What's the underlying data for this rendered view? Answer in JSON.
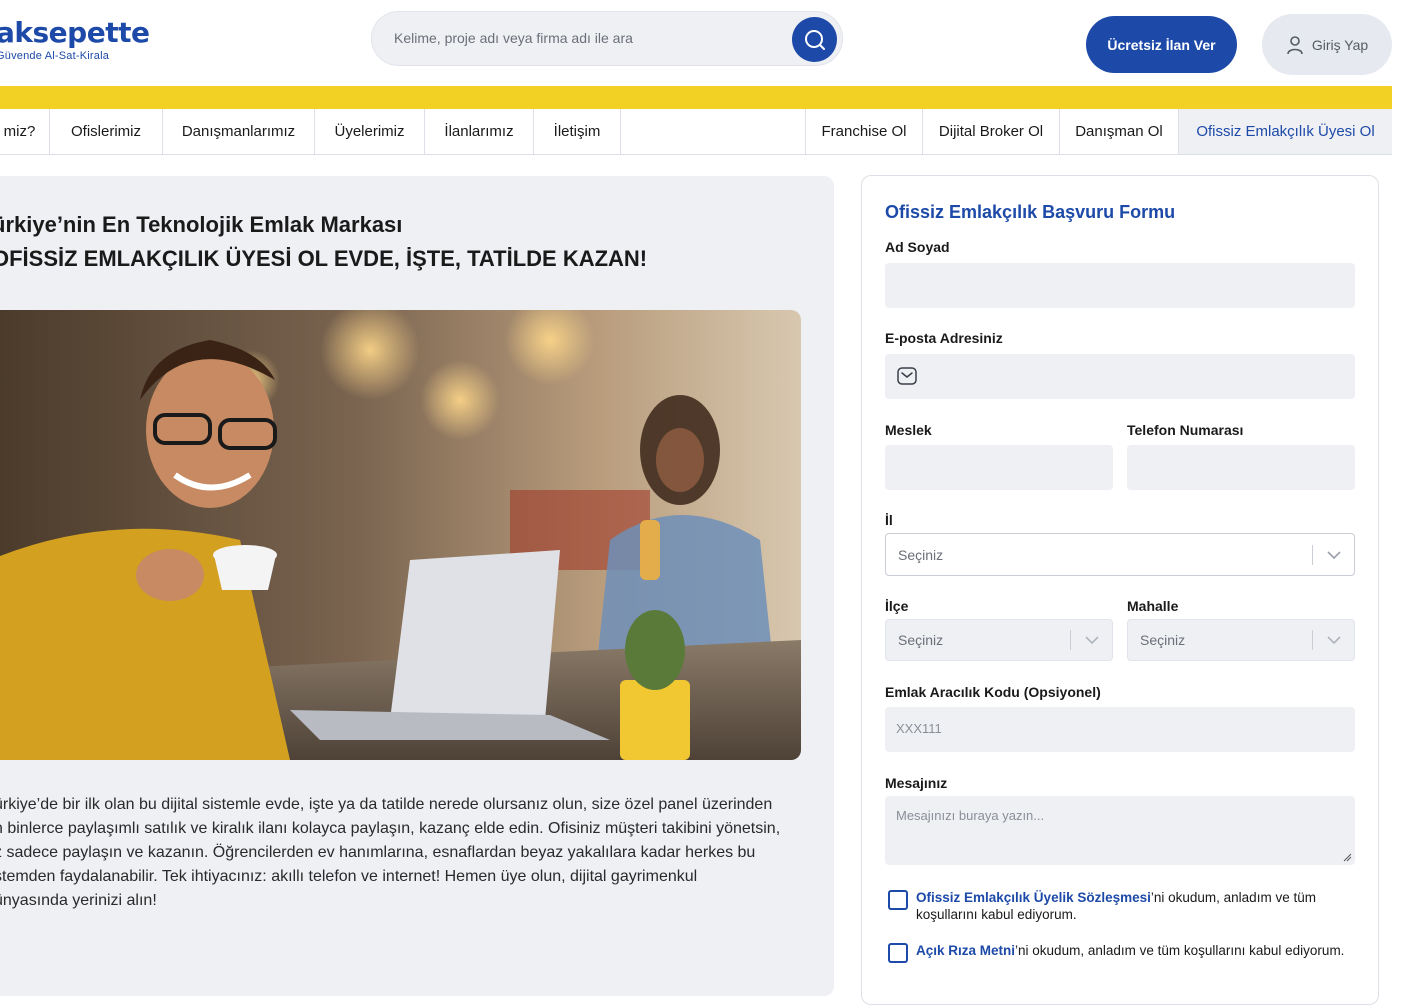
{
  "header": {
    "logo_text": "aksepette",
    "logo_tagline": "Güvende Al-Sat-Kirala",
    "search_placeholder": "Kelime, proje adı veya firma adı ile ara",
    "post_ad_label": "Ücretsiz İlan Ver",
    "login_label": "Giriş Yap"
  },
  "nav": {
    "left": [
      "miz?",
      "Ofislerimiz",
      "Danışmanlarımız",
      "Üyelerimiz",
      "İlanlarımız",
      "İletişim"
    ],
    "right": [
      "Franchise Ol",
      "Dijital Broker Ol",
      "Danışman Ol",
      "Ofissiz Emlakçılık Üyesi Ol"
    ]
  },
  "main": {
    "heading_line1": "ürkiye’nin En Teknolojik Emlak Markası",
    "heading_line2": "OFİSSİZ EMLAKÇILIK ÜYESİ OL EVDE, İŞTE, TATİLDE KAZAN!",
    "body_lines": [
      "ürkiye’de bir ilk olan bu dijital sistemle evde, işte ya da tatilde nerede olursanız olun, size özel panel üzerinden",
      "n binlerce paylaşımlı satılık ve kiralık ilanı kolayca paylaşın, kazanç elde edin. Ofisiniz müşteri takibini yönetsin,",
      "z sadece paylaşın ve kazanın. Öğrencilerden ev hanımlarına, esnaflardan beyaz yakalılara kadar herkes bu",
      "stemden faydalanabilir. Tek ihtiyacınız: akıllı telefon ve internet! Hemen üye olun, dijital gayrimenkul",
      "ünyasında yerinizi alın!"
    ]
  },
  "form": {
    "title": "Ofissiz Emlakçılık Başvuru Formu",
    "name_label": "Ad Soyad",
    "email_label": "E-posta Adresiniz",
    "job_label": "Meslek",
    "phone_label": "Telefon Numarası",
    "city_label": "İl",
    "city_value": "Seçiniz",
    "district_label": "İlçe",
    "district_value": "Seçiniz",
    "neighborhood_label": "Mahalle",
    "neighborhood_value": "Seçiniz",
    "code_label": "Emlak Aracılık Kodu (Opsiyonel)",
    "code_placeholder": "XXX111",
    "message_label": "Mesajınız",
    "message_placeholder": "Mesajınızı buraya yazın...",
    "consent1_link": "Ofissiz Emlakçılık Üyelik Sözleşmesi",
    "consent1_text": "’ni okudum, anladım ve tüm koşullarını kabul ediyorum.",
    "consent2_link": "Açık Rıza Metni",
    "consent2_text": "’ni okudum, anladım ve tüm koşullarını kabul ediyorum."
  },
  "colors": {
    "brand_blue": "#1d4aa8",
    "accent_yellow": "#f2d024",
    "panel_gray": "#eef0f4"
  }
}
